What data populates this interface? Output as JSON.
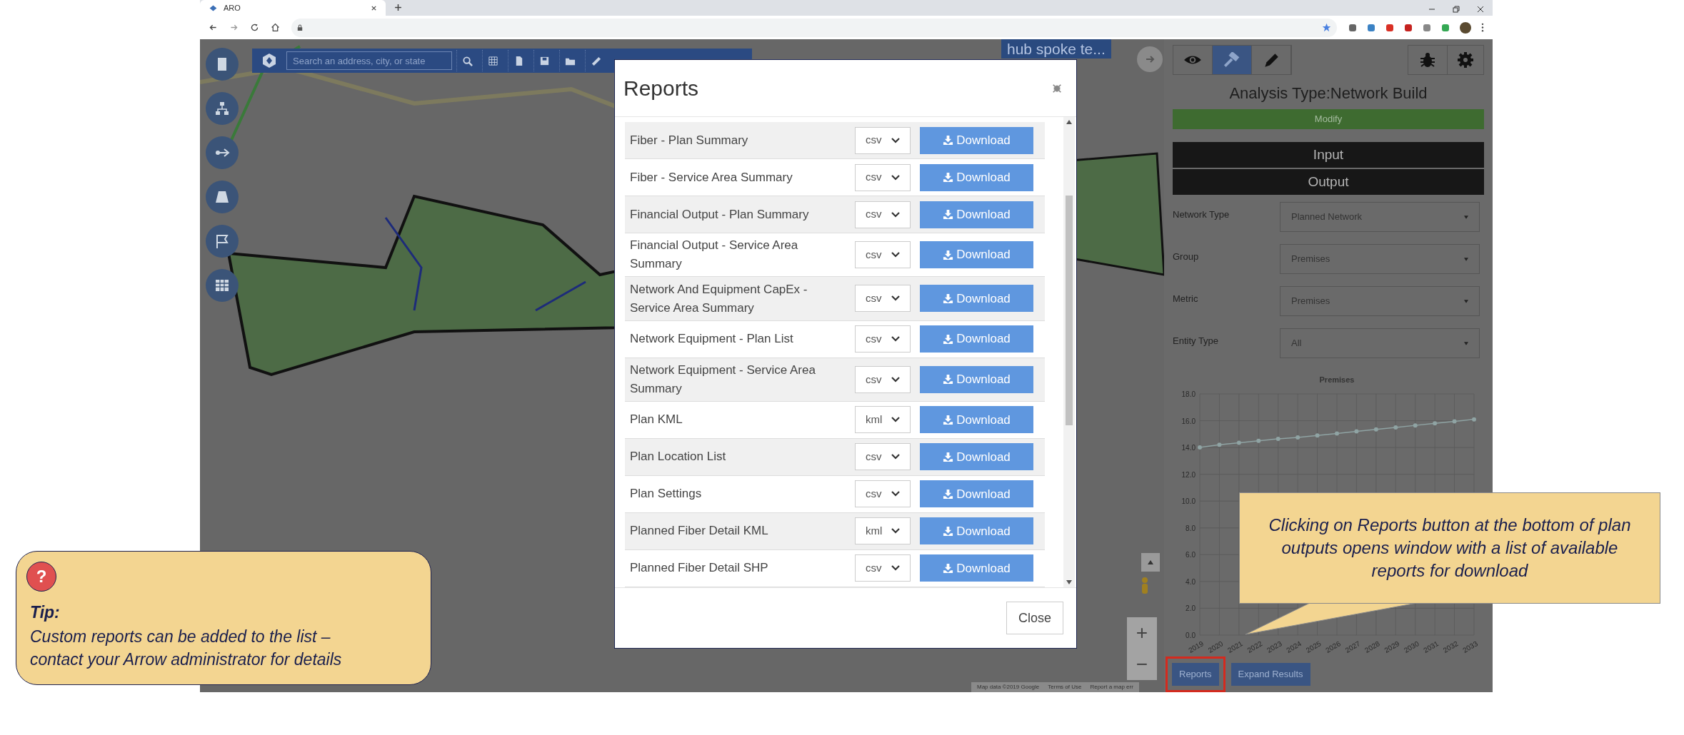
{
  "browser": {
    "tab_title": "ARO"
  },
  "map_toolbar": {
    "search_placeholder": "Search an address, city, or state"
  },
  "plan_label": "hub spoke te...",
  "view_tabs": [
    {
      "kind": "eye",
      "selected": false
    },
    {
      "kind": "hammer",
      "selected": true
    },
    {
      "kind": "pencil",
      "selected": false
    }
  ],
  "right_panel": {
    "title": "Analysis Type:Network Build",
    "modify_button": "Modify",
    "sections": [
      "Input",
      "Output"
    ],
    "fields": [
      {
        "label": "Network Type",
        "value": "Planned Network"
      },
      {
        "label": "Group",
        "value": "Premises"
      },
      {
        "label": "Metric",
        "value": "Premises"
      },
      {
        "label": "Entity Type",
        "value": "All"
      }
    ],
    "chart_data": {
      "type": "line",
      "title": "Premises",
      "categories": [
        "2019",
        "2020",
        "2021",
        "2022",
        "2023",
        "2024",
        "2025",
        "2026",
        "2027",
        "2028",
        "2029",
        "2030",
        "2031",
        "2032",
        "2033"
      ],
      "grid": true,
      "series": [
        {
          "color": "#8fa3a3",
          "marker": true,
          "values": [
            14.0,
            14.2,
            14.35,
            14.5,
            14.65,
            14.75,
            14.9,
            15.05,
            15.2,
            15.35,
            15.5,
            15.65,
            15.8,
            15.95,
            16.1
          ]
        }
      ],
      "ylim": [
        0,
        18
      ],
      "yticks": [
        {
          "value": 0,
          "label": "0.0"
        },
        {
          "value": 2,
          "label": "2.0"
        },
        {
          "value": 4,
          "label": "4.0"
        },
        {
          "value": 6,
          "label": "6.0"
        },
        {
          "value": 8,
          "label": "8.0"
        },
        {
          "value": 10,
          "label": "10.0"
        },
        {
          "value": 12,
          "label": "12.0"
        },
        {
          "value": 14,
          "label": "14.0"
        },
        {
          "value": 16,
          "label": "16.0"
        },
        {
          "value": 18,
          "label": "18.0"
        }
      ]
    },
    "buttons": [
      {
        "label": "Reports",
        "highlighted": true
      },
      {
        "label": "Expand Results",
        "highlighted": false
      }
    ]
  },
  "map_controls": {
    "zoom_in": "+",
    "zoom_out": "−"
  },
  "map_attribution": [
    "Map data ©2019 Google",
    "Terms of Use",
    "Report a map err"
  ],
  "reports_dialog": {
    "title": "Reports",
    "rows": [
      {
        "name": "Fiber - Plan Summary",
        "format": "csv",
        "button": "Download"
      },
      {
        "name": "Fiber - Service Area Summary",
        "format": "csv",
        "button": "Download"
      },
      {
        "name": "Financial Output - Plan Summary",
        "format": "csv",
        "button": "Download"
      },
      {
        "name": "Financial Output - Service Area Summary",
        "format": "csv",
        "button": "Download"
      },
      {
        "name": "Network And Equipment CapEx - Service Area Summary",
        "format": "csv",
        "button": "Download"
      },
      {
        "name": "Network Equipment - Plan List",
        "format": "csv",
        "button": "Download"
      },
      {
        "name": "Network Equipment - Service Area Summary",
        "format": "csv",
        "button": "Download"
      },
      {
        "name": "Plan KML",
        "format": "kml",
        "button": "Download"
      },
      {
        "name": "Plan Location List",
        "format": "csv",
        "button": "Download"
      },
      {
        "name": "Plan Settings",
        "format": "csv",
        "button": "Download"
      },
      {
        "name": "Planned Fiber Detail KML",
        "format": "kml",
        "button": "Download"
      },
      {
        "name": "Planned Fiber Detail SHP",
        "format": "csv",
        "button": "Download"
      }
    ],
    "close_button": "Close"
  },
  "tip": {
    "icon": "?",
    "heading": "Tip:",
    "text": "Custom reports can be added to the list – contact your Arrow administrator for details"
  },
  "callout": {
    "text": "Clicking on Reports button at the bottom of plan outputs opens window with a list of available reports for download"
  }
}
